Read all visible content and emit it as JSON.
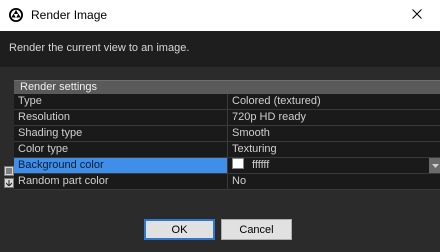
{
  "window": {
    "title": "Render Image",
    "app_icon": "aperture-icon",
    "close_icon": "close-icon"
  },
  "description": "Render the current view to an image.",
  "property_grid": {
    "section_title": "Render settings",
    "rows": [
      {
        "name": "Type",
        "value": "Colored (textured)"
      },
      {
        "name": "Resolution",
        "value": "720p HD ready"
      },
      {
        "name": "Shading type",
        "value": "Smooth"
      },
      {
        "name": "Color type",
        "value": "Texturing"
      },
      {
        "name": "Background color",
        "value": "ffffff",
        "swatch": "#ffffff",
        "selected": true
      },
      {
        "name": "Random part color",
        "value": "No"
      }
    ],
    "selection_color": "#3f8fe8"
  },
  "buttons": {
    "ok": "OK",
    "cancel": "Cancel"
  }
}
